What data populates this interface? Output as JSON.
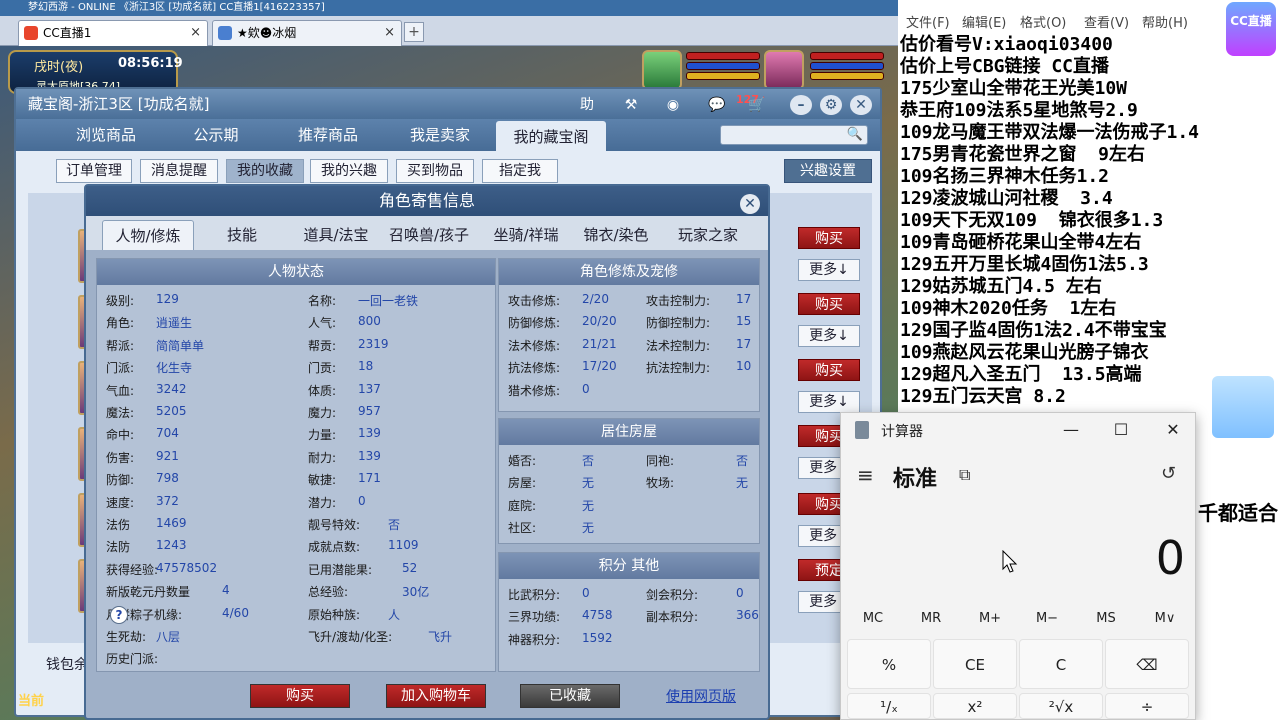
{
  "browser": {
    "title_text": "梦幻西游 - ONLINE    《浙江3区 [功成名就]    CC直播1[416223357]",
    "tabs": [
      {
        "label": "CC直播1",
        "close": "×"
      },
      {
        "label": "★欸☻冰烟",
        "close": "×"
      }
    ],
    "new_tab": "+"
  },
  "game_hud": {
    "time_period": "戌时(夜)",
    "clock": "08:56:19",
    "location": "灵太原地[36,74]",
    "now_label": "当前"
  },
  "cbg": {
    "title": "藏宝阁-浙江3区 [功成名就]",
    "toolbar": {
      "help": "助",
      "message_count": "127"
    },
    "nav_tabs": [
      "浏览商品",
      "公示期",
      "推荐商品",
      "我是卖家",
      "我的藏宝阁"
    ],
    "sub_buttons": [
      "订单管理",
      "消息提醒",
      "我的收藏",
      "我的兴趣",
      "买到物品",
      "指定我"
    ],
    "interest_settings": "兴趣设置",
    "buy_label": "购买",
    "more_label": "更多↓",
    "reserve_label": "预定",
    "wallet_label": "钱包余"
  },
  "role": {
    "title": "角色寄售信息",
    "close": "✕",
    "tabs": [
      "人物/修炼",
      "技能",
      "道具/法宝",
      "召唤兽/孩子",
      "坐骑/祥瑞",
      "锦衣/染色",
      "玩家之家"
    ],
    "status_header": "人物状态",
    "status_left": [
      {
        "label": "级别:",
        "value": "129"
      },
      {
        "label": "角色:",
        "value": "逍遥生"
      },
      {
        "label": "帮派:",
        "value": "简简单单"
      },
      {
        "label": "门派:",
        "value": "化生寺"
      },
      {
        "label": "气血:",
        "value": "3242"
      },
      {
        "label": "魔法:",
        "value": "5205"
      },
      {
        "label": "命中:",
        "value": "704"
      },
      {
        "label": "伤害:",
        "value": "921"
      },
      {
        "label": "防御:",
        "value": "798"
      },
      {
        "label": "速度:",
        "value": "372"
      },
      {
        "label": "法伤",
        "value": "1469"
      },
      {
        "label": "法防",
        "value": "1243"
      },
      {
        "label": "获得经验:",
        "value": "47578502"
      },
      {
        "label": "新版乾元丹数量",
        "value": "4"
      },
      {
        "label": "月饼粽子机缘:",
        "value": "4/60"
      },
      {
        "label": "生死劫:",
        "value": "八层"
      },
      {
        "label": "历史门派:",
        "value": ""
      }
    ],
    "status_right": [
      {
        "label": "名称:",
        "value": "一回一老铁"
      },
      {
        "label": "人气:",
        "value": "800"
      },
      {
        "label": "帮贡:",
        "value": "2319"
      },
      {
        "label": "门贡:",
        "value": "18"
      },
      {
        "label": "体质:",
        "value": "137"
      },
      {
        "label": "魔力:",
        "value": "957"
      },
      {
        "label": "力量:",
        "value": "139"
      },
      {
        "label": "耐力:",
        "value": "139"
      },
      {
        "label": "敏捷:",
        "value": "171"
      },
      {
        "label": "潜力:",
        "value": "0"
      },
      {
        "label": "靓号特效:",
        "value": "否"
      },
      {
        "label": "成就点数:",
        "value": "1109"
      },
      {
        "label": "已用潜能果:",
        "value": "52"
      },
      {
        "label": "总经验:",
        "value": "30亿"
      },
      {
        "label": "原始种族:",
        "value": "人"
      },
      {
        "label": "飞升/渡劫/化圣:",
        "value": "飞升"
      }
    ],
    "cultivation_header": "角色修炼及宠修",
    "cultivation": [
      {
        "label": "攻击修炼:",
        "value": "2/20",
        "label2": "攻击控制力:",
        "value2": "17"
      },
      {
        "label": "防御修炼:",
        "value": "20/20",
        "label2": "防御控制力:",
        "value2": "15"
      },
      {
        "label": "法术修炼:",
        "value": "21/21",
        "label2": "法术控制力:",
        "value2": "17"
      },
      {
        "label": "抗法修炼:",
        "value": "17/20",
        "label2": "抗法控制力:",
        "value2": "10"
      },
      {
        "label": "猎术修炼:",
        "value": "0",
        "label2": "",
        "value2": ""
      }
    ],
    "house_header": "居住房屋",
    "house": [
      {
        "label": "婚否:",
        "value": "否",
        "label2": "同袍:",
        "value2": "否"
      },
      {
        "label": "房屋:",
        "value": "无",
        "label2": "牧场:",
        "value2": "无"
      },
      {
        "label": "庭院:",
        "value": "无",
        "label2": "",
        "value2": ""
      },
      {
        "label": "社区:",
        "value": "无",
        "label2": "",
        "value2": ""
      }
    ],
    "score_header": "积分 其他",
    "scores": [
      {
        "label": "比武积分:",
        "value": "0",
        "label2": "剑会积分:",
        "value2": "0"
      },
      {
        "label": "三界功绩:",
        "value": "4758",
        "label2": "副本积分:",
        "value2": "366"
      },
      {
        "label": "神器积分:",
        "value": "1592",
        "label2": "",
        "value2": ""
      }
    ],
    "help_glyph": "?",
    "footer": {
      "buy": "购买",
      "add_cart": "加入购物车",
      "collected": "已收藏",
      "web_version": "使用网页版"
    }
  },
  "notepad": {
    "menu": [
      "文件(F)",
      "编辑(E)",
      "格式(O)",
      "查看(V)",
      "帮助(H)"
    ],
    "lines": [
      "估价看号V:xiaoqi03400",
      "估价上号CBG链接 CC直播",
      "175少室山全带花王光美10W",
      "恭王府109法系5星地煞号2.9",
      "109龙马魔王带双法爆一法伤戒子1.4",
      "175男青花瓷世界之窗  9左右",
      "109名扬三界神木任务1.2",
      "129凌波城山河社稷  3.4",
      "109天下无双109  锦衣很多1.3",
      "109青岛砸桥花果山全带4左右",
      "129五开万里长城4固伤1法5.3",
      "129姑苏城五门4.5 左右",
      "109神木2020任务  1左右",
      "129国子监4固伤1法2.4不带宝宝",
      "109燕赵风云花果山光膀子锦衣",
      "129超凡入圣五门  13.5高端",
      "129五门云天宫 8.2"
    ],
    "tail_text": "千都适合",
    "cc_logo": "CC直播"
  },
  "calculator": {
    "title": "计算器",
    "minimize": "—",
    "maximize": "☐",
    "close": "✕",
    "menu_icon": "≡",
    "mode": "标准",
    "keep_on_top": "⧉",
    "history_icon": "↺",
    "display": "0",
    "memory": [
      "MC",
      "MR",
      "M+",
      "M−",
      "MS",
      "M∨"
    ],
    "keys_row1": [
      "%",
      "CE",
      "C",
      "⌫"
    ],
    "keys_row2": [
      "¹/ₓ",
      "x²",
      "²√x",
      "÷"
    ]
  }
}
